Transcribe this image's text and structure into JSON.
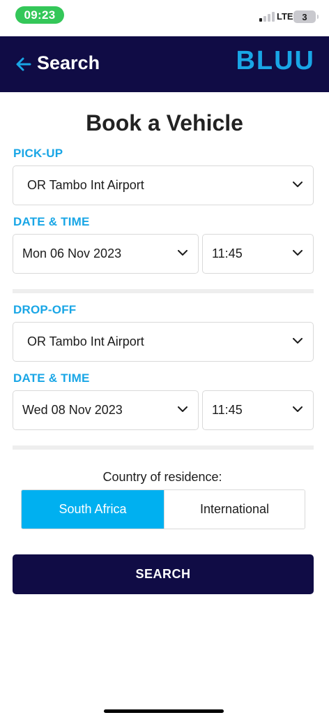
{
  "status_bar": {
    "time": "09:23",
    "network": "LTE",
    "battery": "3"
  },
  "header": {
    "back_label": "Search",
    "brand": "BLUU",
    "icons": {
      "back": "arrow-left-icon"
    }
  },
  "form": {
    "title": "Book a Vehicle",
    "pickup": {
      "label": "PICK-UP",
      "location": "OR Tambo Int Airport",
      "datetime_label": "DATE & TIME",
      "date": "Mon 06 Nov 2023",
      "time": "11:45"
    },
    "dropoff": {
      "label": "DROP-OFF",
      "location": "OR Tambo Int Airport",
      "datetime_label": "DATE & TIME",
      "date": "Wed 08 Nov 2023",
      "time": "11:45"
    },
    "residence": {
      "label": "Country of residence:",
      "options": [
        "South Africa",
        "International"
      ],
      "selected": "South Africa"
    },
    "search_label": "SEARCH"
  },
  "colors": {
    "navy": "#100c45",
    "accent": "#19a6e6",
    "selected": "#00b0f0",
    "status_green": "#34c759"
  }
}
